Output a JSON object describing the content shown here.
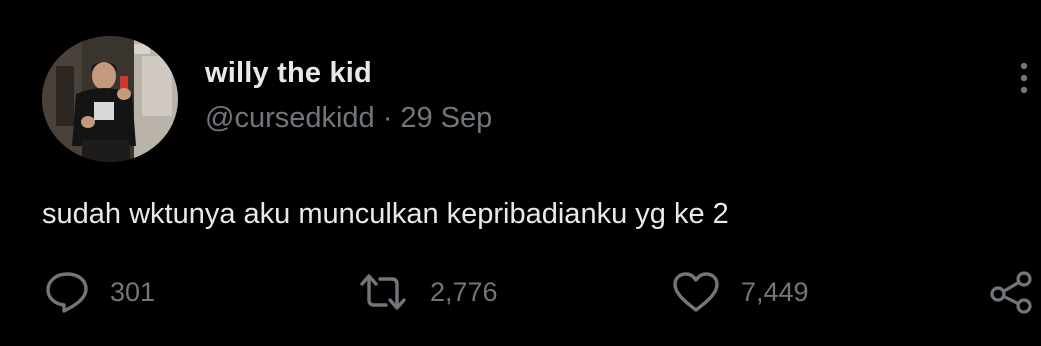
{
  "author": {
    "display_name": "willy the kid",
    "handle": "@cursedkidd",
    "separator": "·",
    "date": "29 Sep"
  },
  "tweet": {
    "text": "sudah wktunya aku munculkan kepribadianku yg ke 2"
  },
  "actions": {
    "reply_count": "301",
    "retweet_count": "2,776",
    "like_count": "7,449"
  },
  "icons": {
    "more": "more-vertical-icon",
    "reply": "reply-icon",
    "retweet": "retweet-icon",
    "like": "heart-icon",
    "share": "share-icon"
  },
  "colors": {
    "background": "#000000",
    "primary_text": "#e7e9ea",
    "secondary_text": "#71767b"
  }
}
